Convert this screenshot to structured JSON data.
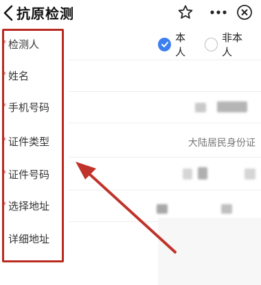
{
  "header": {
    "title": "抗原检测",
    "icons": [
      "back-icon",
      "star-icon",
      "more-icon",
      "close-icon"
    ]
  },
  "form": {
    "required_mark": "*",
    "fields": [
      {
        "label": "检测人",
        "required": true
      },
      {
        "label": "姓名",
        "required": true
      },
      {
        "label": "手机号码",
        "required": true
      },
      {
        "label": "证件类型",
        "required": true,
        "value": "大陆居民身份证"
      },
      {
        "label": "证件号码",
        "required": true
      },
      {
        "label": "选择地址",
        "required": true
      },
      {
        "label": "详细地址",
        "required": false
      }
    ],
    "tester_options": [
      {
        "label": "本人",
        "checked": true
      },
      {
        "label": "非本人",
        "checked": false
      }
    ]
  },
  "colors": {
    "accent": "#3d7ef0",
    "annotation": "#b8291e",
    "required": "#d0443c"
  }
}
